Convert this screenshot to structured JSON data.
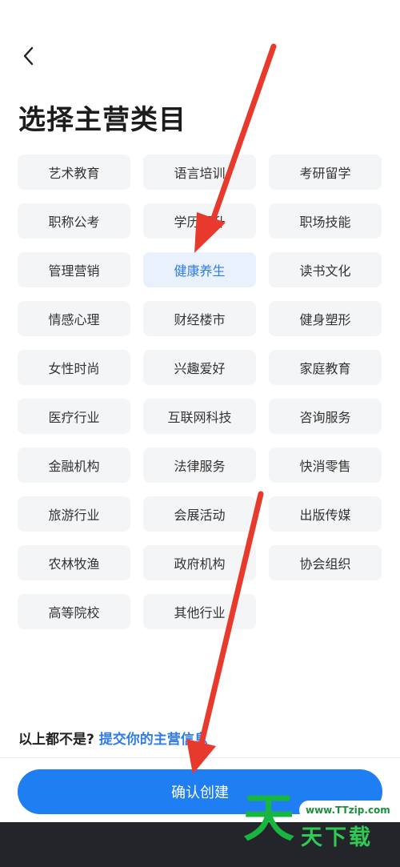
{
  "header": {
    "back_icon": "chevron-left-icon",
    "title": "选择主营类目"
  },
  "categories": [
    "艺术教育",
    "语言培训",
    "考研留学",
    "职称公考",
    "学历提升",
    "职场技能",
    "管理营销",
    "健康养生",
    "读书文化",
    "情感心理",
    "财经楼市",
    "健身塑形",
    "女性时尚",
    "兴趣爱好",
    "家庭教育",
    "医疗行业",
    "互联网科技",
    "咨询服务",
    "金融机构",
    "法律服务",
    "快消零售",
    "旅游行业",
    "会展活动",
    "出版传媒",
    "农林牧渔",
    "政府机构",
    "协会组织",
    "高等院校",
    "其他行业"
  ],
  "selected_category": "健康养生",
  "footer": {
    "question": "以上都不是?",
    "link": "提交你的主营信息"
  },
  "confirm_button": "确认创建",
  "watermark": {
    "url": "www.TTzip.com",
    "big": "天",
    "small": "天下载"
  },
  "colors": {
    "accent": "#1f7ef2",
    "selected_text": "#2f7ce6",
    "selected_bg": "#e9f1fd",
    "chip_bg": "#f4f5f7",
    "annotation_arrow": "#e83a2c"
  }
}
